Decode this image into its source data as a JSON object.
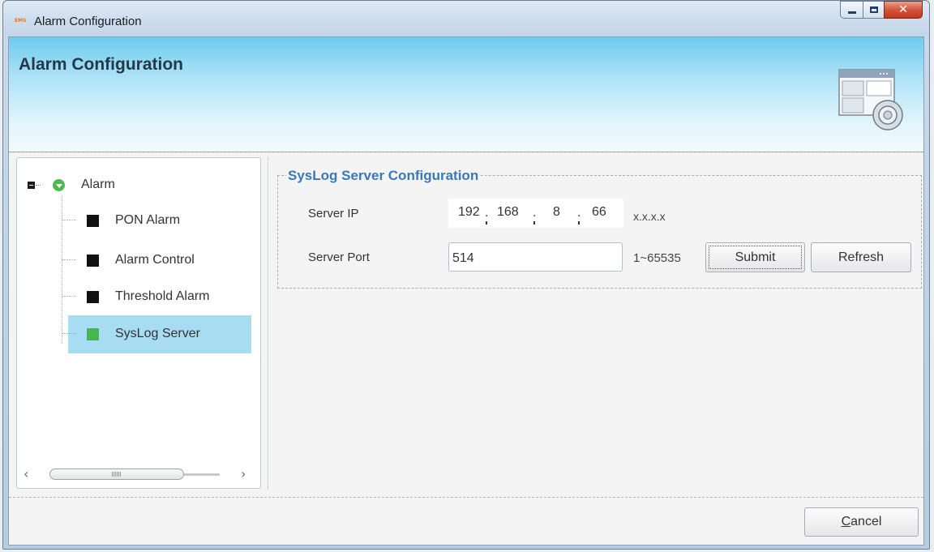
{
  "window": {
    "title": "Alarm Configuration",
    "app_icon_text": "EMS"
  },
  "banner": {
    "title": "Alarm Configuration",
    "icon": "settings-window-icon"
  },
  "tree": {
    "root": {
      "label": "Alarm",
      "icon": "green-expand-icon"
    },
    "items": [
      {
        "label": "PON Alarm",
        "color": "#111111"
      },
      {
        "label": "Alarm Control",
        "color": "#111111"
      },
      {
        "label": "Threshold Alarm",
        "color": "#111111"
      },
      {
        "label": "SysLog Server",
        "color": "#46b84a",
        "selected": true
      }
    ],
    "selected_color": "#a8dcf2"
  },
  "syslog": {
    "legend": "SysLog Server Configuration",
    "server_ip_label": "Server IP",
    "ip_octets": [
      "192",
      "168",
      "8",
      "66"
    ],
    "ip_separator": ".",
    "ip_hint": "x.x.x.x",
    "server_port_label": "Server Port",
    "server_port_value": "514",
    "port_hint": "1~65535",
    "submit_label": "Submit",
    "refresh_label": "Refresh"
  },
  "footer": {
    "cancel_label": "Cancel"
  },
  "colors": {
    "legend_blue": "#3a78b8",
    "banner_blue": "#6ccbed"
  }
}
